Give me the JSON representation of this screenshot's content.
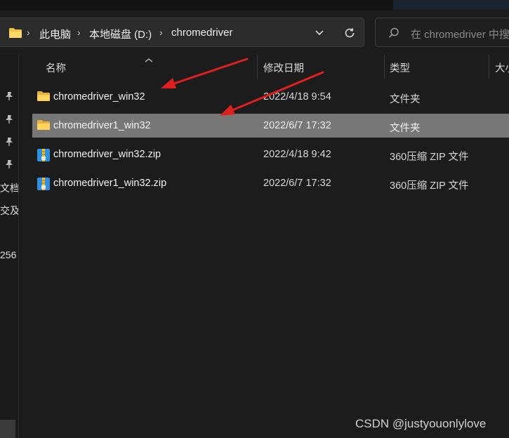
{
  "address_bar": {
    "breadcrumbs": [
      "此电脑",
      "本地磁盘 (D:)",
      "chromedriver"
    ]
  },
  "search": {
    "placeholder": "在 chromedriver 中搜索"
  },
  "nav_pane": {
    "partial_labels": [
      "文档",
      "交及",
      "256"
    ]
  },
  "columns": {
    "name": "名称",
    "modified": "修改日期",
    "type": "类型",
    "size": "大小"
  },
  "files": [
    {
      "name": "chromedriver_win32",
      "modified": "2022/4/18 9:54",
      "type": "文件夹",
      "icon": "folder-icon",
      "selected": false
    },
    {
      "name": "chromedriver1_win32",
      "modified": "2022/6/7 17:32",
      "type": "文件夹",
      "icon": "folder-icon",
      "selected": true
    },
    {
      "name": "chromedriver_win32.zip",
      "modified": "2022/4/18 9:42",
      "type": "360压缩 ZIP 文件",
      "icon": "zip-archive-icon",
      "selected": false
    },
    {
      "name": "chromedriver1_win32.zip",
      "modified": "2022/6/7 17:32",
      "type": "360压缩 ZIP 文件",
      "icon": "zip-archive-icon",
      "selected": false
    }
  ],
  "watermark": "CSDN @justyouonlylove",
  "colors": {
    "background": "#1c1c1c",
    "selected_row": "#777777",
    "annotation_arrow": "#e02020",
    "folder": "#f5c542"
  }
}
